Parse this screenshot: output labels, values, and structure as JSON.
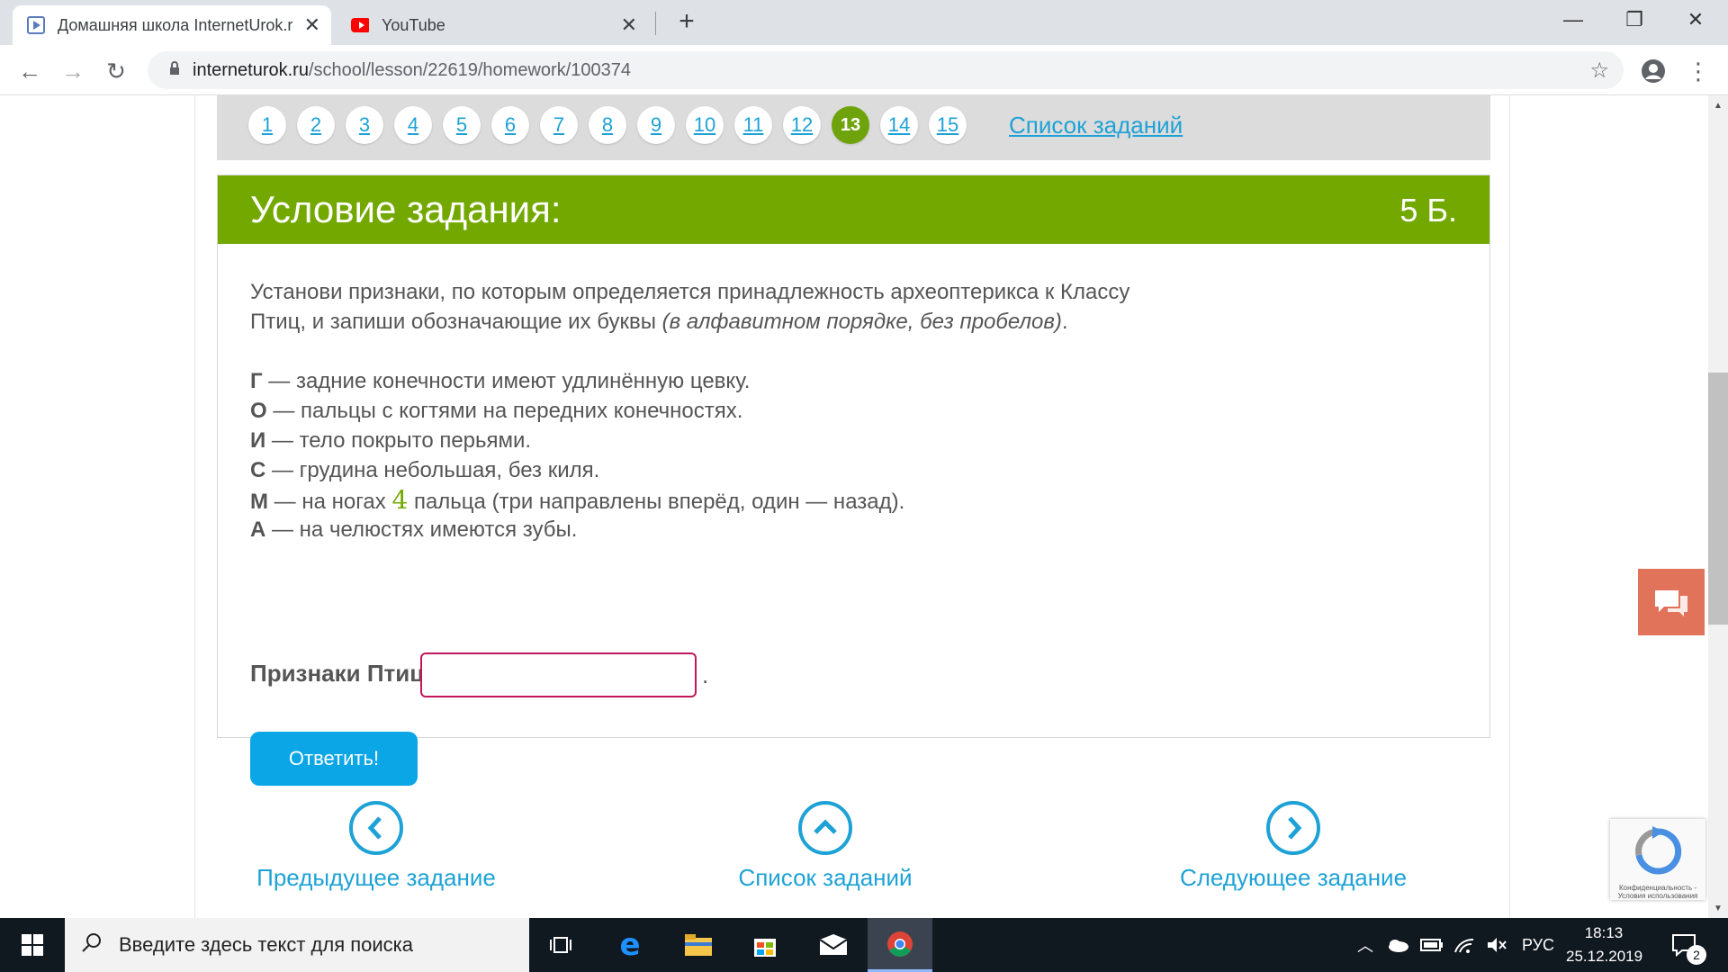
{
  "browser": {
    "tabs": [
      {
        "title": "Домашняя школа InternetUrok.r",
        "active": true,
        "icon": "play-icon"
      },
      {
        "title": "YouTube",
        "active": false,
        "icon": "youtube-icon"
      }
    ],
    "new_tab": "+",
    "url_host": "interneturok.ru",
    "url_path": "/school/lesson/22619/homework/100374"
  },
  "task_nav": {
    "numbers": [
      "1",
      "2",
      "3",
      "4",
      "5",
      "6",
      "7",
      "8",
      "9",
      "10",
      "11",
      "12",
      "13",
      "14",
      "15"
    ],
    "current": "13",
    "list_link": "Список заданий"
  },
  "card": {
    "title": "Условие задания:",
    "score": "5 Б.",
    "intro_line1": "Установи признаки, по которым определяется принадлежность археоптерикса к Классу",
    "intro_line2_plain": "Птиц, и запиши обозначающие их буквы ",
    "intro_line2_italic": "(в алфавитном порядке, без пробелов)",
    "intro_line2_end": ".",
    "options": [
      {
        "letter": "Г",
        "text": " — задние конечности имеют удлинённую цевку."
      },
      {
        "letter": "О",
        "text": " — пальцы с когтями на передних конечностях."
      },
      {
        "letter": "И",
        "text": " — тело покрыто перьями."
      },
      {
        "letter": "С",
        "text": " — грудина небольшая, без киля."
      },
      {
        "letter": "М",
        "text_before": " — на ногах ",
        "number": "4",
        "text_after": " пальца (три направлены вперёд, один — назад)."
      },
      {
        "letter": "А",
        "text": " — на челюстях имеются зубы."
      }
    ],
    "answer_label": "Признаки Птиц:",
    "answer_value": "",
    "answer_dot": ".",
    "submit_label": "Ответить!"
  },
  "bottom_nav": {
    "prev": "Предыдущее задание",
    "list": "Список заданий",
    "next": "Следующее задание"
  },
  "recaptcha_text": "Конфиденциальность - Условия использования",
  "taskbar": {
    "search_placeholder": "Введите здесь текст для поиска",
    "lang": "РУС",
    "time": "18:13",
    "date": "25.12.2019",
    "notifications": "2"
  },
  "colors": {
    "accent_green": "#73a800",
    "link_blue": "#1ea2d6",
    "button_blue": "#0aa6e6",
    "input_border": "#c2185b",
    "chat_orange": "#e2735b"
  }
}
